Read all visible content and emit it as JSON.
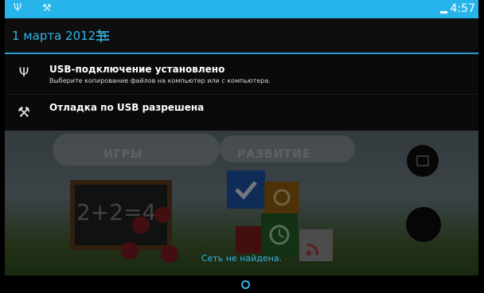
{
  "status_bar": {
    "left_icons": [
      "usb-icon",
      "debug-tools-icon"
    ],
    "time": "4:57",
    "accent_color": "#26b4ea"
  },
  "notification_header": {
    "date": "1 марта 2012 г.",
    "settings_icon": "sliders-icon"
  },
  "notifications": [
    {
      "icon": "usb-icon",
      "title": "USB-подключение установлено",
      "subtitle": "Выберите копирование файлов на компьютер или с компьютера."
    },
    {
      "icon": "debug-tools-icon",
      "title": "Отладка по USB разрешена"
    }
  ],
  "background_app": {
    "labels": [
      "ИГРЫ",
      "РАЗВИТИЕ"
    ],
    "board_text": "2+2=4",
    "toast": "Сеть не найдена."
  },
  "nav_bar": {
    "home_icon": "home-circle-icon"
  }
}
